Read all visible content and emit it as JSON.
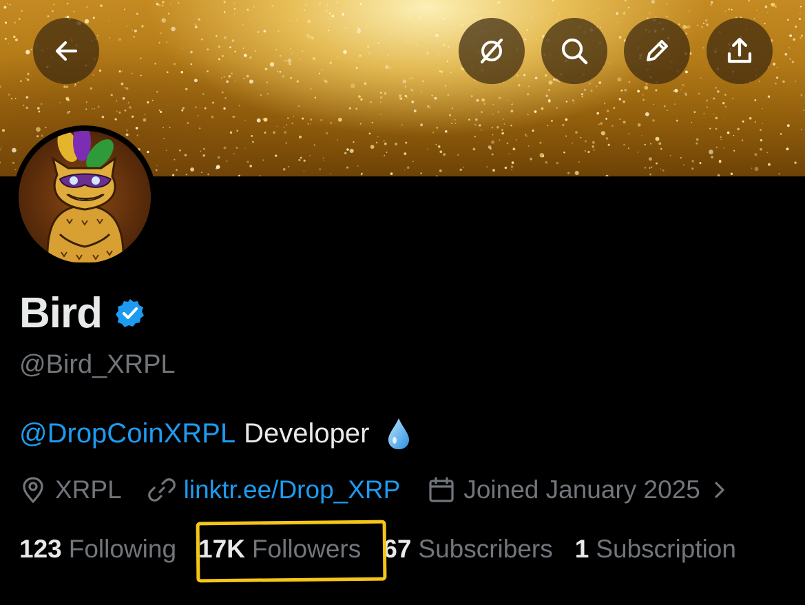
{
  "header": {
    "back_icon": "arrow-left-icon",
    "grok_icon": "grok-slash-icon",
    "search_icon": "search-icon",
    "edit_icon": "pencil-icon",
    "share_icon": "share-upload-icon",
    "banner_style": "gold glitter"
  },
  "profile": {
    "display_name": "Bird",
    "verified_icon": "verified-badge-icon",
    "verified_color": "#1d9bf0",
    "handle": "@Bird_XRPL",
    "bio": {
      "mention": "@DropCoinXRPL",
      "text": "Developer",
      "emoji_icon": "droplet-icon"
    },
    "location": "XRPL",
    "website": "linktr.ee/Drop_XRP",
    "joined": "Joined January 2025"
  },
  "stats": {
    "following_count": "123",
    "following_label": "Following",
    "followers_count": "17K",
    "followers_label": "Followers",
    "subscribers_count": "67",
    "subscribers_label": "Subscribers",
    "subscription_count": "1",
    "subscription_label": "Subscription"
  },
  "colors": {
    "background": "#000000",
    "primary_text": "#e7e9ea",
    "secondary_text": "#71767b",
    "link": "#1d9bf0",
    "highlight_annotation": "#f5c518"
  }
}
